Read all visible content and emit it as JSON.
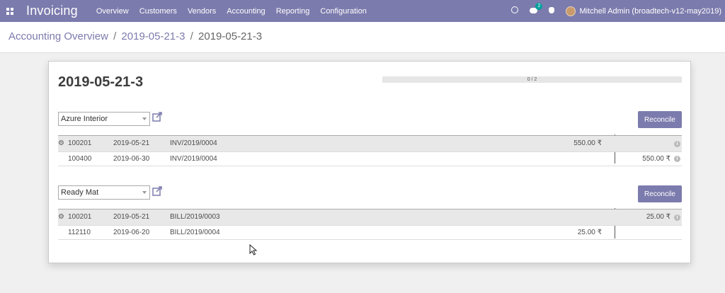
{
  "navbar": {
    "brand": "Invoicing",
    "menu": [
      "Overview",
      "Customers",
      "Vendors",
      "Accounting",
      "Reporting",
      "Configuration"
    ],
    "chat_badge": "2",
    "user": "Mitchell Admin (broadtech-v12-may2019)",
    "color": "#7c7bad"
  },
  "breadcrumb": {
    "root": "Accounting Overview",
    "sep1": "/",
    "mid": "2019-05-21-3",
    "sep2": "/",
    "current": "2019-05-21-3"
  },
  "sheet": {
    "title": "2019-05-21-3",
    "progress_text": "0 / 2",
    "progress_value": 0
  },
  "reconcile_blocks": [
    {
      "partner": "Azure Interior",
      "button": "Reconcile",
      "lines": [
        {
          "account": "100201",
          "date": "2019-05-21",
          "ref": "INV/2019/0004",
          "debit": "550.00 ₹",
          "credit": ""
        },
        {
          "account": "100400",
          "date": "2019-06-30",
          "ref": "INV/2019/0004",
          "debit": "",
          "credit": "550.00 ₹"
        }
      ]
    },
    {
      "partner": "Ready Mat",
      "button": "Reconcile",
      "lines": [
        {
          "account": "100201",
          "date": "2019-05-21",
          "ref": "BILL/2019/0003",
          "debit": "",
          "credit": "25.00 ₹"
        },
        {
          "account": "112110",
          "date": "2019-06-20",
          "ref": "BILL/2019/0004",
          "debit": "25.00 ₹",
          "credit": ""
        }
      ]
    }
  ]
}
